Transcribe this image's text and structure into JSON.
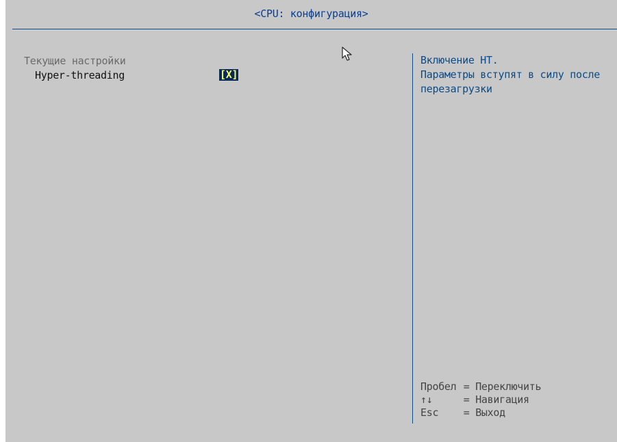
{
  "header": {
    "title": "<CPU: конфигурация>"
  },
  "settings": {
    "section_label": "Текущие настройки",
    "items": [
      {
        "label": "Hyper-threading",
        "value": "[X]"
      }
    ]
  },
  "help": {
    "lines": [
      "Включение HT.",
      "Параметры вступят в силу после",
      "перезагрузки"
    ]
  },
  "keys": [
    {
      "key": "Пробел",
      "action": "= Переключить"
    },
    {
      "key": "↑↓",
      "action": "= Навигация"
    },
    {
      "key": "Esc",
      "action": "= Выход"
    }
  ],
  "colors": {
    "background": "#c8c8c8",
    "accent": "#0a4b87",
    "value_bg": "#0a2a5a",
    "value_fg": "#ffff66"
  },
  "icons": {
    "pointer": "mouse-pointer-icon"
  }
}
